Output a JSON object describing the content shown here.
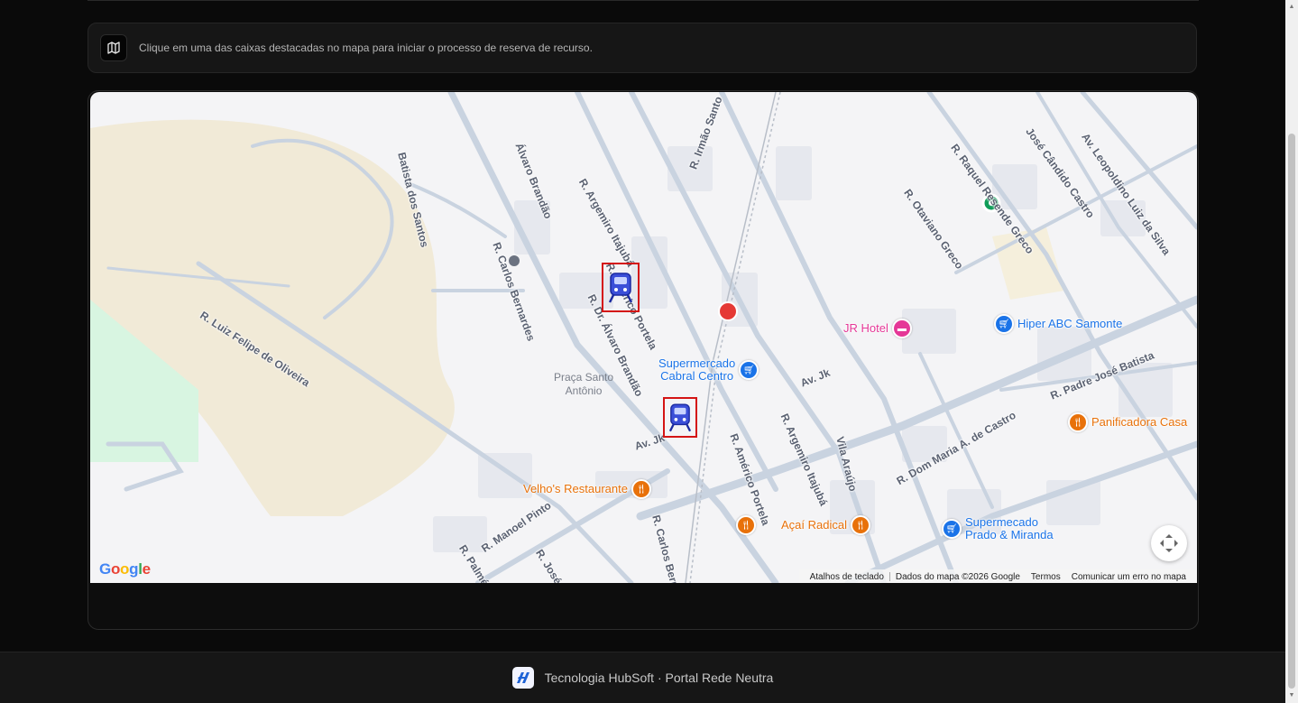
{
  "info": {
    "icon": "map-icon",
    "message": "Clique em uma das caixas destacadas no mapa para iniciar o processo de reserva de recurso."
  },
  "map": {
    "streets": [
      {
        "name": "Batista dos Santos"
      },
      {
        "name": "Álvaro Brandão"
      },
      {
        "name": "R. Carlos Bernardes"
      },
      {
        "name": "R. Argemiro Itajubá"
      },
      {
        "name": "R. Irmão Santo"
      },
      {
        "name": "R. Américo Portela"
      },
      {
        "name": "R. Dr. Álvaro Brandão"
      },
      {
        "name": "R. Luiz Felipe de Oliveira"
      },
      {
        "name": "R. Raquel Resende Greco"
      },
      {
        "name": "José Cândido Castro"
      },
      {
        "name": "Av. Leopoldino Luiz da Silva"
      },
      {
        "name": "R. Otaviano Greco"
      },
      {
        "name": "Av. Jk"
      },
      {
        "name": "Av. Jk"
      },
      {
        "name": "R. Américo Portela"
      },
      {
        "name": "R. Argemiro Itajubá"
      },
      {
        "name": "Vila Araújo"
      },
      {
        "name": "R. Dom Maria A. de Castro"
      },
      {
        "name": "R. Padre José Batista"
      },
      {
        "name": "R. Manoel Pinto"
      },
      {
        "name": "R. Palmério"
      },
      {
        "name": "R. José C"
      },
      {
        "name": "R. Carlos Bern"
      }
    ],
    "pois": [
      {
        "name": "JR Hotel",
        "color": "#e53797",
        "icon": "hotel-icon"
      },
      {
        "name": "Hiper ABC Samonte",
        "color": "#1a73e8",
        "icon": "cart-icon"
      },
      {
        "name": "Supermercado\nCabral Centro",
        "color": "#1a73e8",
        "icon": "cart-icon"
      },
      {
        "name": "Panificadora Casa",
        "color": "#e8710a",
        "icon": "restaurant-icon"
      },
      {
        "name": "Velho's Restaurante",
        "color": "#e8710a",
        "icon": "restaurant-icon"
      },
      {
        "name": "Açaí Radical",
        "color": "#e8710a",
        "icon": "restaurant-icon"
      },
      {
        "name": "Supermecado\nPrado & Miranda",
        "color": "#1a73e8",
        "icon": "cart-icon"
      }
    ],
    "place_label": "Praça Santo\nAntônio",
    "station_markers": [
      {
        "name": "train-station-marker-1",
        "icon": "train-icon"
      },
      {
        "name": "train-station-marker-2",
        "icon": "train-icon"
      }
    ],
    "google_logo": "Google",
    "footer_links": [
      "Atalhos de teclado",
      "Dados do mapa ©2026 Google",
      "Termos",
      "Comunicar um erro no mapa"
    ]
  },
  "footer": {
    "text": "Tecnologia HubSoft · Portal Rede Neutra"
  },
  "colors": {
    "marker_border": "#d41414",
    "background": "#0a0a0a",
    "card": "#161616"
  }
}
